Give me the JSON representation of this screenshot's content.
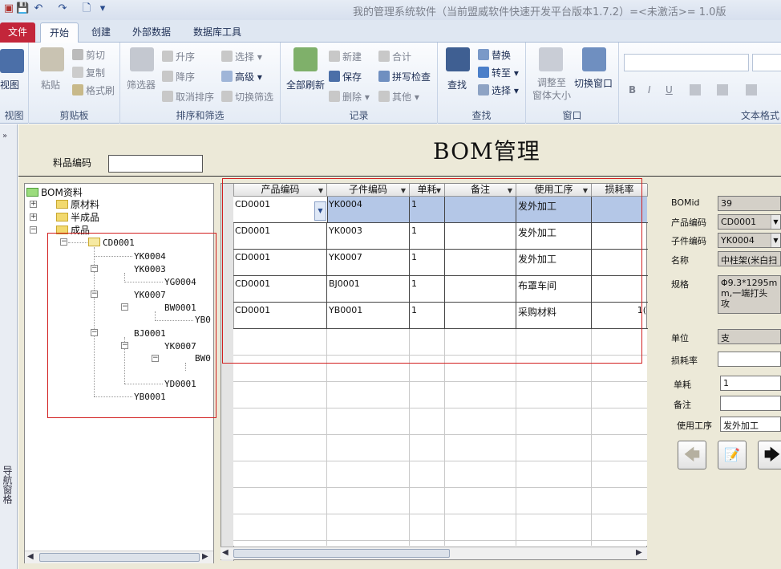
{
  "window_title": "我的管理系统软件（当前盟威软件快速开发平台版本1.7.2）=<未激活>= 1.0版",
  "tabs": [
    "文件",
    "开始",
    "创建",
    "外部数据",
    "数据库工具"
  ],
  "ribbon": {
    "view": {
      "label": "视图",
      "group": "视图"
    },
    "clipboard": {
      "paste": "粘贴",
      "cut": "剪切",
      "copy": "复制",
      "format_painter": "格式刷",
      "group": "剪贴板"
    },
    "sort_filter": {
      "filter": "筛选器",
      "asc": "升序",
      "desc": "降序",
      "clear_sort": "取消排序",
      "selection": "选择",
      "advanced": "高级",
      "toggle_filter": "切换筛选",
      "group": "排序和筛选"
    },
    "records": {
      "refresh_all": "全部刷新",
      "new": "新建",
      "save": "保存",
      "delete": "删除",
      "totals": "合计",
      "spelling": "拼写检查",
      "more": "其他",
      "group": "记录"
    },
    "find": {
      "find": "查找",
      "replace": "替换",
      "goto": "转至",
      "select": "选择",
      "group": "查找"
    },
    "window": {
      "fit": "调整至\n窗体大小",
      "switch": "切换窗口",
      "group": "窗口"
    },
    "text_format": {
      "group": "文本格式",
      "bold": "B",
      "italic": "I",
      "underline": "U"
    }
  },
  "left_nav_label": "导航窗格",
  "form": {
    "title": "BOM管理",
    "material_code_label": "料品编码",
    "material_code_value": ""
  },
  "tree": {
    "root": "BOM资料",
    "l1": [
      "原材料",
      "半成品",
      "成品"
    ],
    "nodes": [
      "CD0001",
      "YK0004",
      "YK0003",
      "YG0004",
      "YK0007",
      "BW0001",
      "YB0",
      "BJ0001",
      "YK0007",
      "BW0",
      "YD0001",
      "YB0001"
    ]
  },
  "grid": {
    "columns": [
      "产品编码",
      "子件编码",
      "单耗",
      "备注",
      "使用工序",
      "损耗率"
    ],
    "rows": [
      {
        "product": "CD0001",
        "part": "YK0004",
        "qty": "1",
        "note": "",
        "process": "发外加工",
        "loss": ""
      },
      {
        "product": "CD0001",
        "part": "YK0003",
        "qty": "1",
        "note": "",
        "process": "发外加工",
        "loss": ""
      },
      {
        "product": "CD0001",
        "part": "YK0007",
        "qty": "1",
        "note": "",
        "process": "发外加工",
        "loss": ""
      },
      {
        "product": "CD0001",
        "part": "BJ0001",
        "qty": "1",
        "note": "",
        "process": "布罩车间",
        "loss": ""
      },
      {
        "product": "CD0001",
        "part": "YB0001",
        "qty": "1",
        "note": "",
        "process": "采购材料",
        "loss": "1("
      }
    ]
  },
  "detail": {
    "bomid_label": "BOMid",
    "bomid": "39",
    "product_label": "产品编码",
    "product": "CD0001",
    "part_label": "子件编码",
    "part": "YK0004",
    "name_label": "名称",
    "name": "中柱架(米白扫",
    "spec_label": "规格",
    "spec": "Φ9.3*1295m\nm,一端打头\n攻",
    "unit_label": "单位",
    "unit": "支",
    "loss_label": "损耗率",
    "loss": "",
    "qty_label": "单耗",
    "qty": "1",
    "note_label": "备注",
    "note": "",
    "process_label": "使用工序",
    "process": "发外加工"
  }
}
